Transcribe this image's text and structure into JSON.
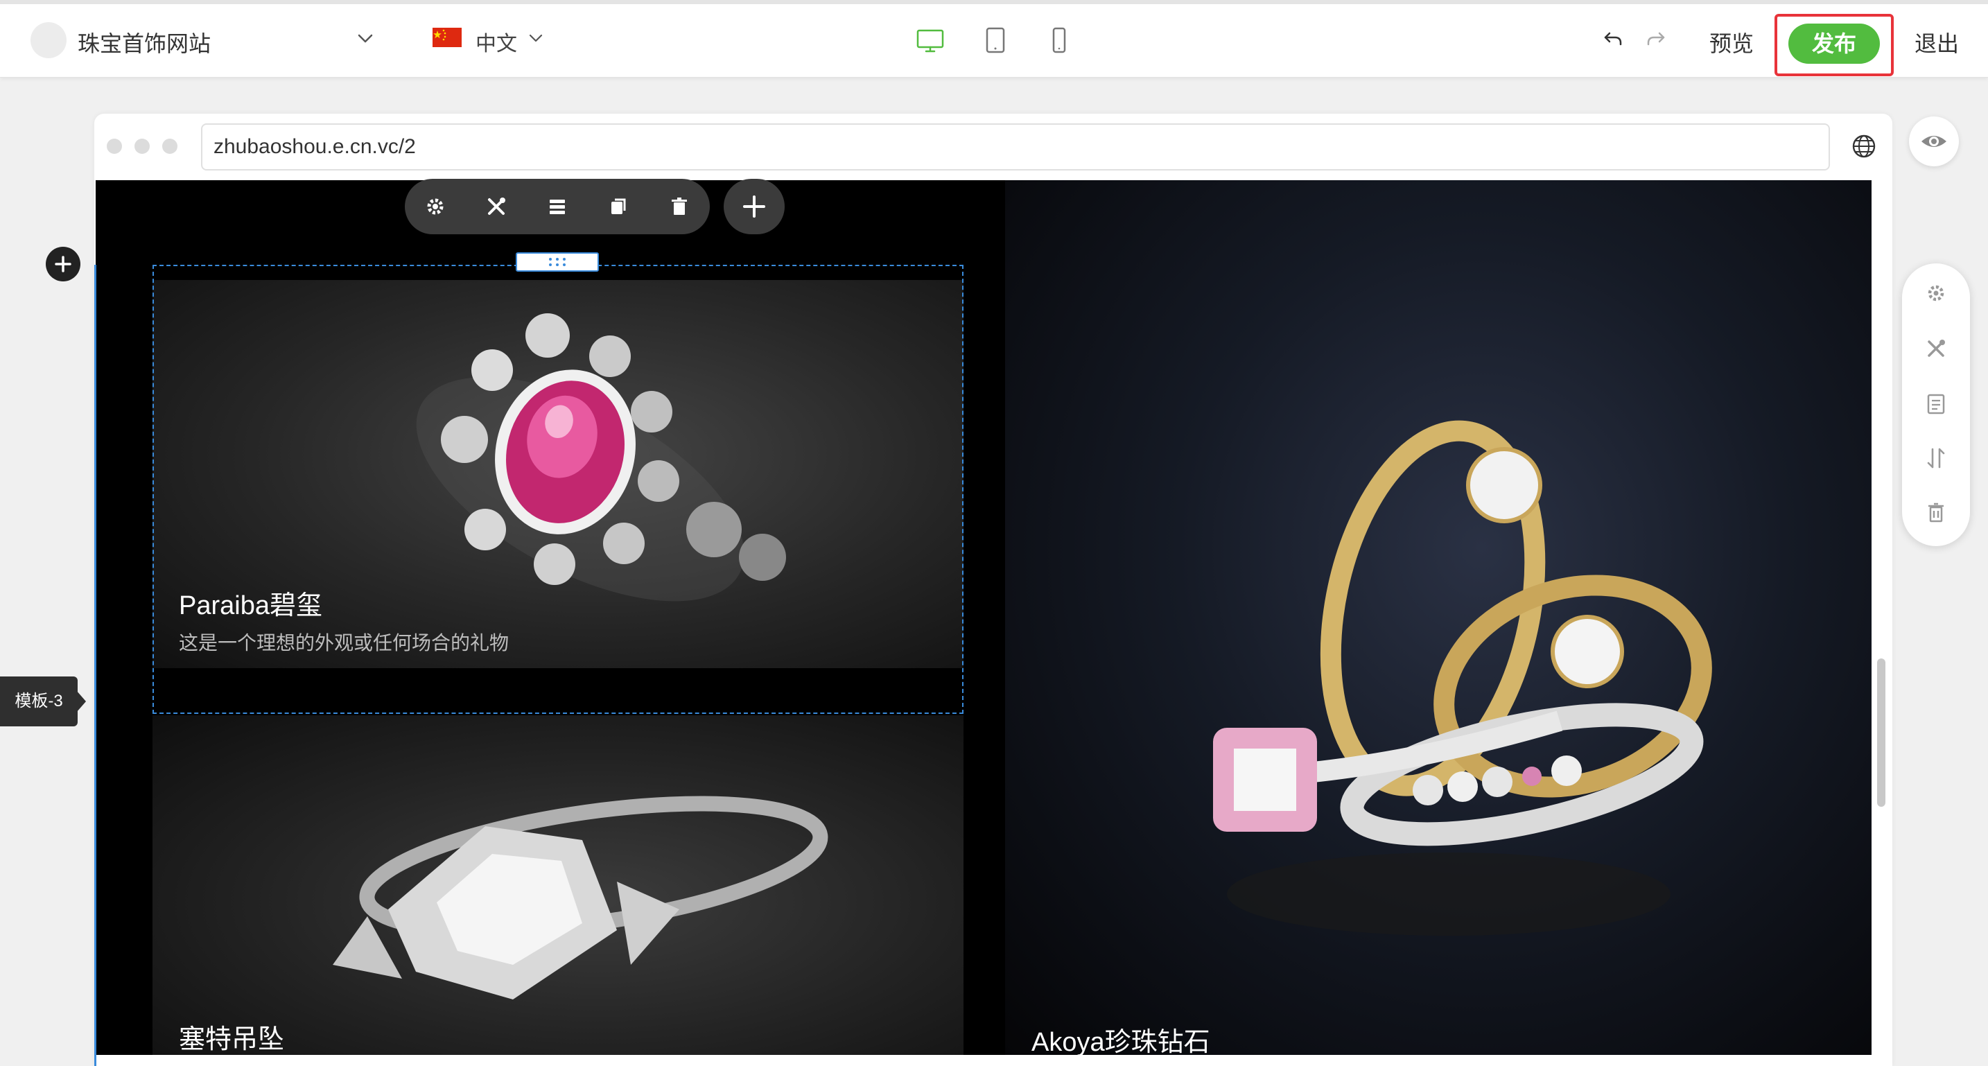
{
  "topbar": {
    "site_name": "珠宝首饰网站",
    "language": "中文",
    "preview_label": "预览",
    "publish_label": "发布",
    "exit_label": "退出",
    "active_device": "desktop",
    "accent_color": "#52bc3f",
    "highlight_color": "#e8333a"
  },
  "browser": {
    "url": "zhubaoshou.e.cn.vc/2"
  },
  "block_toolbar": {
    "icons": [
      "gear-icon",
      "design-icon",
      "layers-icon",
      "copy-icon",
      "trash-icon"
    ],
    "add_icon": "plus-icon"
  },
  "left": {
    "template_label": "模板-3"
  },
  "cards": [
    {
      "title": "Paraiba碧玺",
      "subtitle": "这是一个理想的外观或任何场合的礼物"
    },
    {
      "title": "塞特吊坠"
    },
    {
      "title": "Akoya珍珠钻石"
    }
  ],
  "right_panel": {
    "icons": [
      "gear-icon",
      "design-icon",
      "page-icon",
      "sort-icon",
      "trash-icon"
    ]
  }
}
